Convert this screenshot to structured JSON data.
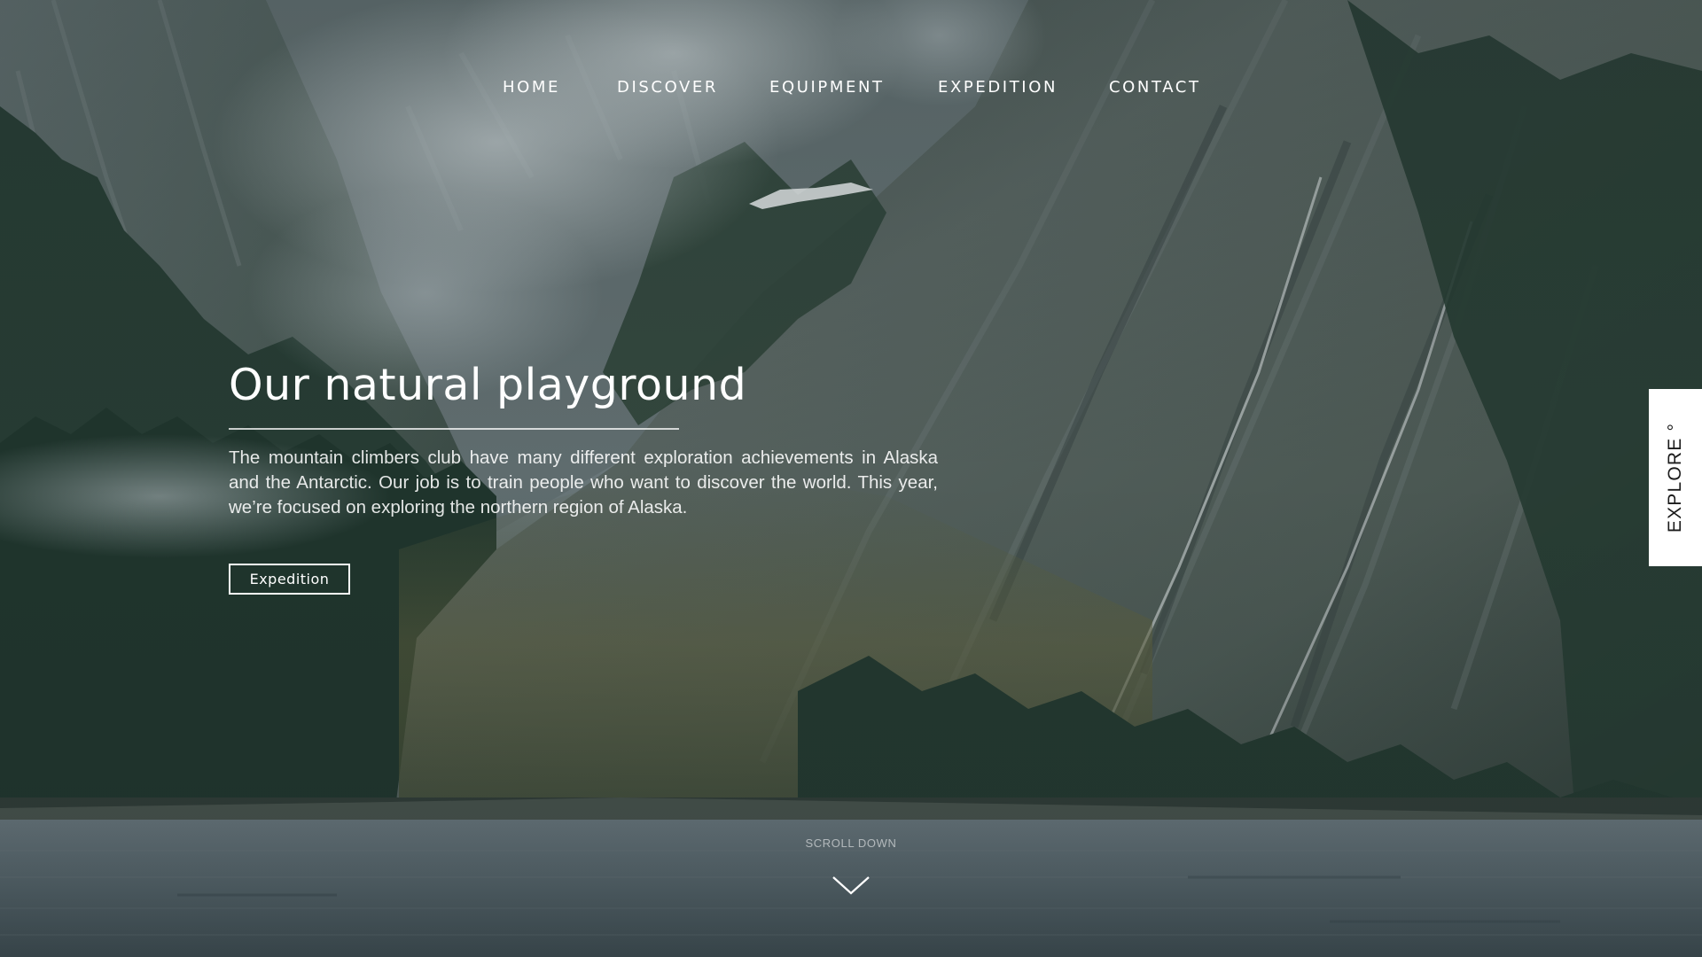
{
  "nav": {
    "items": [
      {
        "label": "HOME"
      },
      {
        "label": "DISCOVER"
      },
      {
        "label": "EQUIPMENT"
      },
      {
        "label": "EXPEDITION"
      },
      {
        "label": "CONTACT"
      }
    ]
  },
  "hero": {
    "title": "Our natural playground",
    "description": "The mountain climbers club have many different exploration achievements in Alaska and the Antarctic. Our job is to train people who want to discover the world. This year, we’re focused on exploring the northern region of Alaska.",
    "cta_label": "Expedition"
  },
  "explore_tab": {
    "label": "EXPLORE °"
  },
  "scroll": {
    "label": "SCROLL DOWN",
    "icon": "chevron-down-icon"
  },
  "colors": {
    "text": "#ffffff",
    "explore_tab_bg": "#ffffff",
    "explore_tab_text": "#1b1b1b",
    "sky_mist": "#8b979b",
    "cliff_dark": "#2c3b39",
    "forest": "#24392f",
    "water": "#56646a"
  }
}
